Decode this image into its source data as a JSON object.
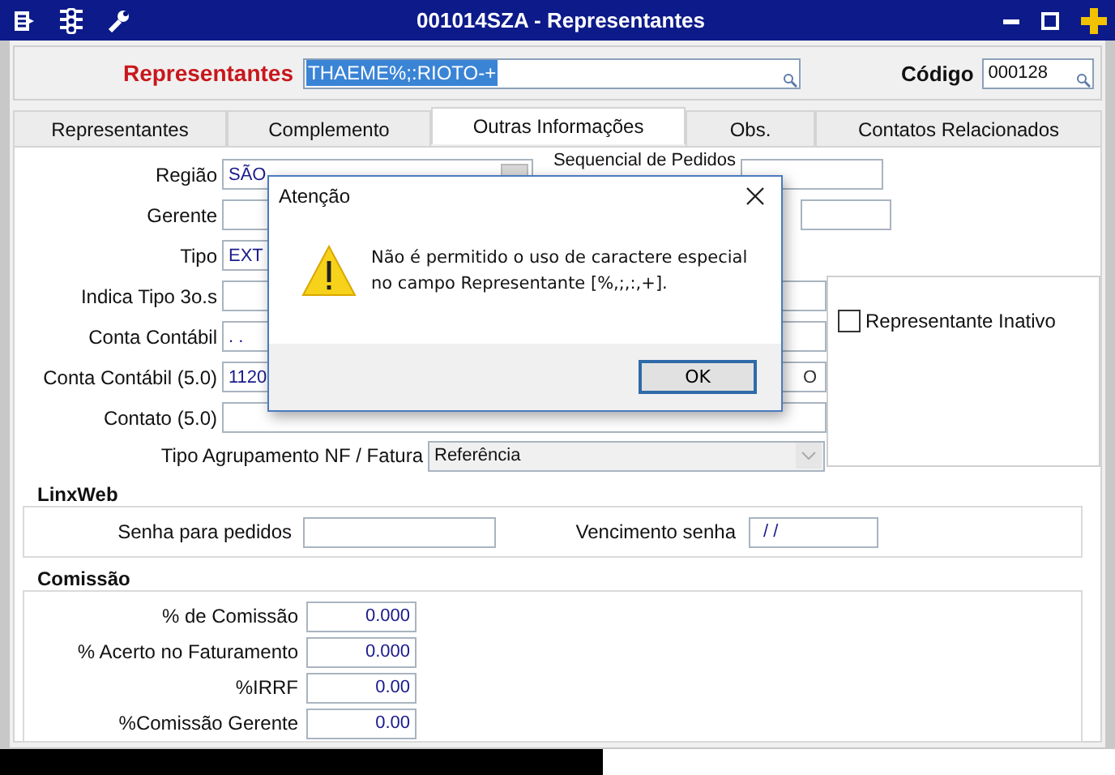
{
  "window": {
    "title": "001014SZA - Representantes"
  },
  "header": {
    "label": "Representantes",
    "value": "THAEME%;:RIOTO-+",
    "code_label": "Código",
    "code_value": "000128"
  },
  "tabs": [
    {
      "label": "Representantes",
      "selected": false
    },
    {
      "label": "Complemento",
      "selected": false
    },
    {
      "label": "Outras Informações",
      "selected": true
    },
    {
      "label": "Obs.",
      "selected": false
    },
    {
      "label": "Contatos Relacionados",
      "selected": false
    }
  ],
  "top_rows": [
    {
      "label": "Região",
      "value": "SÃO",
      "kind": "combo",
      "side_label": "Sequencial de Pedidos",
      "side_field": {
        "kind": "text"
      }
    },
    {
      "label": "Gerente",
      "kind": "text",
      "side_field": {
        "kind": "text"
      }
    },
    {
      "label": "Tipo",
      "value": "EXT",
      "kind": "text"
    }
  ],
  "rows": [
    {
      "label": "Indica Tipo 3o.s",
      "kind": "text"
    },
    {
      "label": "Conta Contábil",
      "value": ". .",
      "kind": "text"
    },
    {
      "label": "Conta Contábil (5.0)",
      "value": "1120",
      "tail": "O",
      "kind": "text"
    },
    {
      "label": "Contato (5.0)",
      "kind": "text"
    }
  ],
  "grouping": {
    "label": "Tipo Agrupamento NF / Fatura",
    "value": "Referência"
  },
  "inactive": {
    "label": "Representante Inativo",
    "checked": false
  },
  "linxweb": {
    "title": "LinxWeb",
    "password_label": "Senha para pedidos",
    "expiry_label": "Vencimento senha",
    "expiry_value": "/ /"
  },
  "commission": {
    "title": "Comissão",
    "rows": [
      {
        "label": "% de Comissão",
        "value": "0.000"
      },
      {
        "label": "% Acerto no Faturamento",
        "value": "0.000"
      },
      {
        "label": "%IRRF",
        "value": "0.00"
      },
      {
        "label": "%Comissão Gerente",
        "value": "0.00"
      }
    ]
  },
  "dialog": {
    "title": "Atenção",
    "lines": [
      "Não é permitido o uso de caractere especial",
      "no campo Representante [%,;,:,+]."
    ],
    "button": "OK"
  }
}
